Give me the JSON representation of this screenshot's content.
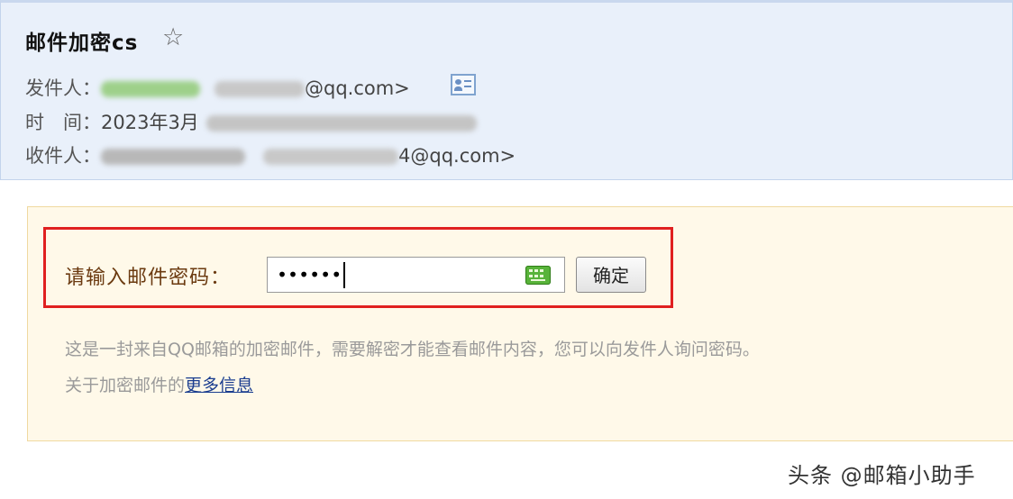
{
  "email": {
    "subject": "邮件加密cs",
    "star_glyph": "☆",
    "sender_label": "发件人：",
    "sender_domain": "@qq.com>",
    "time_label": "时　间：",
    "time_value": "2023年3月",
    "recipient_label": "收件人：",
    "recipient_domain": "4@qq.com>"
  },
  "password_prompt": {
    "label": "请输入邮件密码：",
    "value": "••••••",
    "confirm_button": "确定",
    "info_line1": "这是一封来自QQ邮箱的加密邮件，需要解密才能查看邮件内容，您可以向发件人询问密码。",
    "info_line2_prefix": "关于加密邮件的",
    "info_link": "更多信息"
  },
  "watermark": "头条 @邮箱小助手",
  "colors": {
    "header_bg": "#e9f0fa",
    "panel_bg": "#fff9e9",
    "highlight_border": "#e02020",
    "link": "#1a3d8f"
  }
}
